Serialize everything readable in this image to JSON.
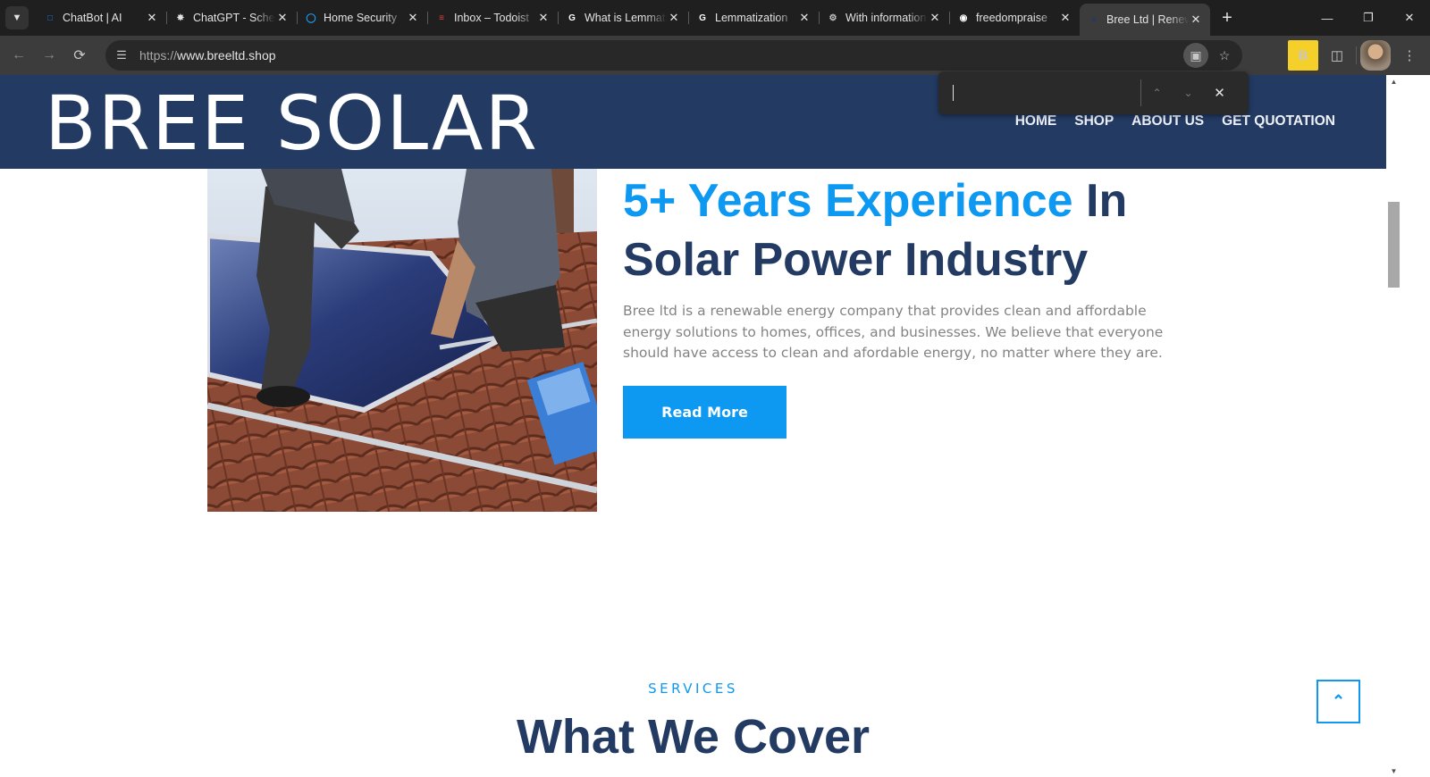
{
  "tabs": [
    {
      "title": "ChatBot | AI",
      "icon": "chatbot-icon",
      "color": "#1a73e8",
      "active": false
    },
    {
      "title": "ChatGPT - Schedule",
      "icon": "chatgpt-icon",
      "color": "#e3e3e3",
      "active": false
    },
    {
      "title": "Home Security",
      "icon": "circle-ring-icon",
      "color": "#1aa3ff",
      "active": false
    },
    {
      "title": "Inbox – Todoist",
      "icon": "todoist-icon",
      "color": "#e44332",
      "active": false
    },
    {
      "title": "What is Lemmatization",
      "icon": "google-icon",
      "color": "#ffffff",
      "active": false
    },
    {
      "title": "Lemmatization",
      "icon": "google-icon",
      "color": "#ffffff",
      "active": false
    },
    {
      "title": "With information",
      "icon": "gear-icon",
      "color": "#c7c7c7",
      "active": false
    },
    {
      "title": "freedompraise",
      "icon": "github-icon",
      "color": "#ffffff",
      "active": false
    },
    {
      "title": "Bree Ltd | Renewable",
      "icon": "site-icon",
      "color": "#233a63",
      "active": true
    }
  ],
  "toolbar": {
    "url_protocol": "https://",
    "url_host": "www.breeltd.shop"
  },
  "findbar": {
    "query": ""
  },
  "site": {
    "logo": "BREE SOLAR",
    "nav": [
      "HOME",
      "SHOP",
      "ABOUT US",
      "GET QUOTATION"
    ]
  },
  "about": {
    "headline_highlight": "5+ Years Experience",
    "headline_rest": " In Solar Power Industry",
    "paragraph": "Bree ltd is a renewable energy company that provides clean and affordable energy solutions to homes, offices, and businesses. We believe that everyone should have access to clean and afordable energy, no matter where they are.",
    "button": "Read More"
  },
  "services": {
    "label": "SERVICES",
    "title": "What We Cover"
  },
  "colors": {
    "header_bg": "#233a63",
    "accent": "#0d98f2",
    "headline_dark": "#233a63",
    "body_text": "#838383"
  }
}
